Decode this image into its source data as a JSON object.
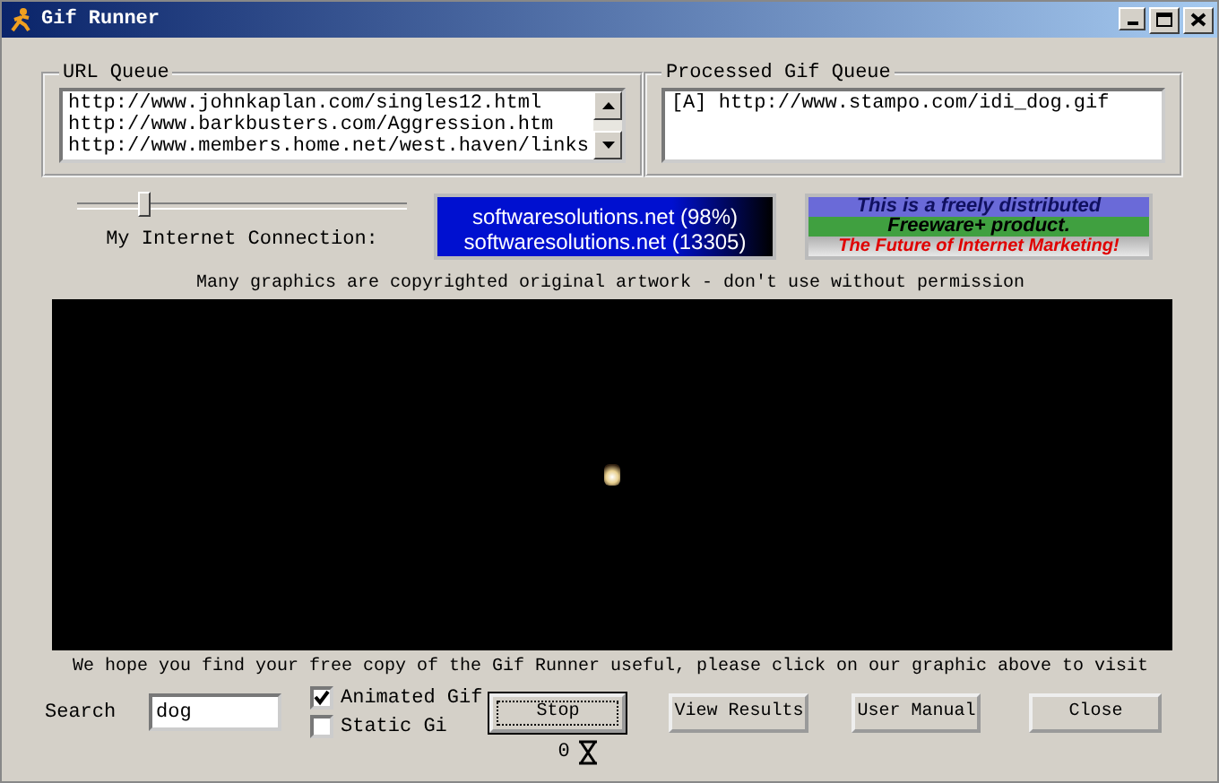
{
  "window": {
    "title": "Gif Runner"
  },
  "url_queue": {
    "label": "URL Queue",
    "items": [
      "http://www.johnkaplan.com/singles12.html",
      "http://www.barkbusters.com/Aggression.htm",
      "http://www.members.home.net/west.haven/links"
    ]
  },
  "processed_queue": {
    "label": "Processed Gif Queue",
    "items": [
      "[A] http://www.stampo.com/idi_dog.gif"
    ]
  },
  "connection": {
    "level": 0.2,
    "label": "My Internet Connection:"
  },
  "banners": [
    {
      "kind": "ticker",
      "lines": [
        "softwaresolutions.net (98%)",
        "softwaresolutions.net (13305)"
      ]
    },
    {
      "kind": "freeware",
      "lines": [
        "This is a freely distributed",
        "Freeware+ product.",
        "The Future of Internet Marketing!"
      ]
    }
  ],
  "notice": "Many graphics are copyrighted original artwork - don't use without permission",
  "footer_note": "We hope you find your free copy of the Gif Runner useful,  please click on our graphic above to visit",
  "search": {
    "label": "Search",
    "value": "dog"
  },
  "options": [
    {
      "label": "Animated Gif",
      "checked": true
    },
    {
      "label": "Static Gi",
      "checked": false
    }
  ],
  "buttons": [
    {
      "label": "Stop",
      "focused": true
    },
    {
      "label": "View Results",
      "focused": false
    },
    {
      "label": "User Manual",
      "focused": false
    },
    {
      "label": "Close",
      "focused": false
    }
  ],
  "counter": "0"
}
